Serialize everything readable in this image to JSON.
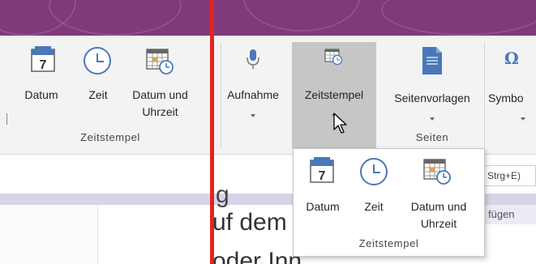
{
  "ribbon": {
    "groups": [
      {
        "label": "Zeitstempel",
        "buttons": [
          {
            "label": "Datum",
            "icon": "calendar-7-icon"
          },
          {
            "label": "Zeit",
            "icon": "clock-icon"
          },
          {
            "label_line1": "Datum und",
            "label_line2": "Uhrzeit",
            "icon": "calendar-clock-icon"
          }
        ]
      },
      {
        "buttons": [
          {
            "label": "Aufnahme",
            "icon": "microphone-icon"
          },
          {
            "label": "Zeitstempel",
            "icon": "timestamp-icon",
            "state": "hovered"
          }
        ]
      },
      {
        "label": "Seiten",
        "buttons": [
          {
            "label": "Seitenvorlagen",
            "icon": "page-template-icon"
          }
        ]
      },
      {
        "buttons": [
          {
            "label": "Symbo",
            "icon": "omega-icon"
          }
        ]
      }
    ]
  },
  "document": {
    "shortcut_text": "Strg+E)",
    "side_text": "fügen",
    "page_text_line1": "uf dem",
    "page_text_partial_top": "g",
    "page_text_line2": "oder Inn"
  },
  "popup": {
    "group_label": "Zeitstempel",
    "items": [
      {
        "label": "Datum",
        "icon": "calendar-7-icon"
      },
      {
        "label": "Zeit",
        "icon": "clock-icon"
      },
      {
        "label_line1": "Datum und",
        "label_line2": "Uhrzeit",
        "icon": "calendar-clock-icon"
      }
    ]
  },
  "colors": {
    "title_bar": "#80397b",
    "ribbon_bg": "#f3f3f3",
    "hover_bg": "#c6c6c6",
    "accent_blue": "#4a78b8",
    "red_line": "#e0261e"
  }
}
